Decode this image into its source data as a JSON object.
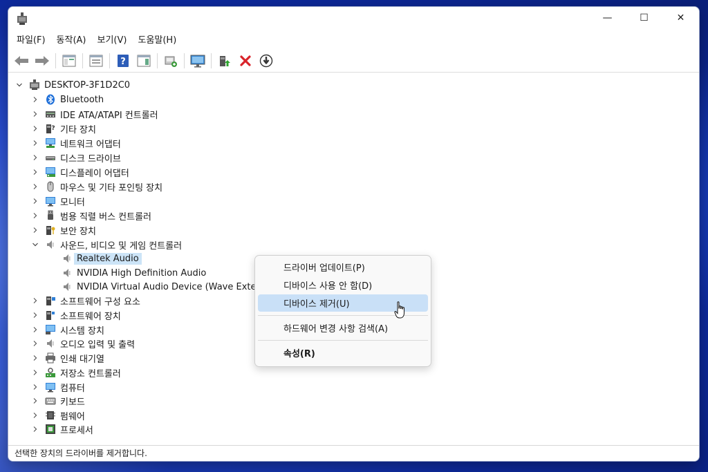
{
  "window": {
    "controls": {
      "minimize": "—",
      "maximize": "☐",
      "close": "✕"
    }
  },
  "menubar": {
    "items": [
      "파일(F)",
      "동작(A)",
      "보기(V)",
      "도움말(H)"
    ]
  },
  "toolbar": {
    "icons": [
      "back-arrow-icon",
      "forward-arrow-icon",
      "show-hide-console-tree-icon",
      "properties-icon",
      "help-icon",
      "action-pane-icon",
      "scan-hardware-icon",
      "monitor-icon",
      "update-driver-icon",
      "uninstall-device-icon",
      "disable-device-icon"
    ]
  },
  "tree": {
    "root": "DESKTOP-3F1D2C0",
    "categories": [
      {
        "label": "Bluetooth",
        "icon": "bluetooth-icon"
      },
      {
        "label": "IDE ATA/ATAPI 컨트롤러",
        "icon": "ide-controller-icon"
      },
      {
        "label": "기타 장치",
        "icon": "other-device-icon"
      },
      {
        "label": "네트워크 어댑터",
        "icon": "network-adapter-icon"
      },
      {
        "label": "디스크 드라이브",
        "icon": "disk-drive-icon"
      },
      {
        "label": "디스플레이 어댑터",
        "icon": "display-adapter-icon"
      },
      {
        "label": "마우스 및 기타 포인팅 장치",
        "icon": "mouse-icon"
      },
      {
        "label": "모니터",
        "icon": "monitor-icon"
      },
      {
        "label": "범용 직렬 버스 컨트롤러",
        "icon": "usb-icon"
      },
      {
        "label": "보안 장치",
        "icon": "security-device-icon"
      },
      {
        "label": "사운드, 비디오 및 게임 컨트롤러",
        "icon": "speaker-icon",
        "expanded": true
      },
      {
        "label": "소프트웨어 구성 요소",
        "icon": "software-component-icon"
      },
      {
        "label": "소프트웨어 장치",
        "icon": "software-device-icon"
      },
      {
        "label": "시스템 장치",
        "icon": "system-device-icon"
      },
      {
        "label": "오디오 입력 및 출력",
        "icon": "audio-io-icon"
      },
      {
        "label": "인쇄 대기열",
        "icon": "printer-icon"
      },
      {
        "label": "저장소 컨트롤러",
        "icon": "storage-controller-icon"
      },
      {
        "label": "컴퓨터",
        "icon": "computer-icon"
      },
      {
        "label": "키보드",
        "icon": "keyboard-icon"
      },
      {
        "label": "펌웨어",
        "icon": "firmware-icon"
      },
      {
        "label": "프로세서",
        "icon": "processor-icon"
      }
    ],
    "sound_children": [
      {
        "label": "Realtek Audio",
        "selected": true
      },
      {
        "label": "NVIDIA High Definition Audio"
      },
      {
        "label": "NVIDIA Virtual Audio Device (Wave Extensible)"
      }
    ]
  },
  "context_menu": {
    "items": [
      {
        "label": "드라이버 업데이트(P)"
      },
      {
        "label": "디바이스 사용 안 함(D)"
      },
      {
        "label": "디바이스 제거(U)",
        "hover": true
      },
      {
        "label": "하드웨어 변경 사항 검색(A)"
      },
      {
        "label": "속성(R)",
        "bold": true
      }
    ]
  },
  "statusbar": {
    "text": "선택한 장치의 드라이버를 제거합니다."
  },
  "colors": {
    "selection": "#cce4f7",
    "menu_hover": "#c9e0f7",
    "accent_red": "#d9232a",
    "desktop_blue": "#2a4fd0"
  }
}
